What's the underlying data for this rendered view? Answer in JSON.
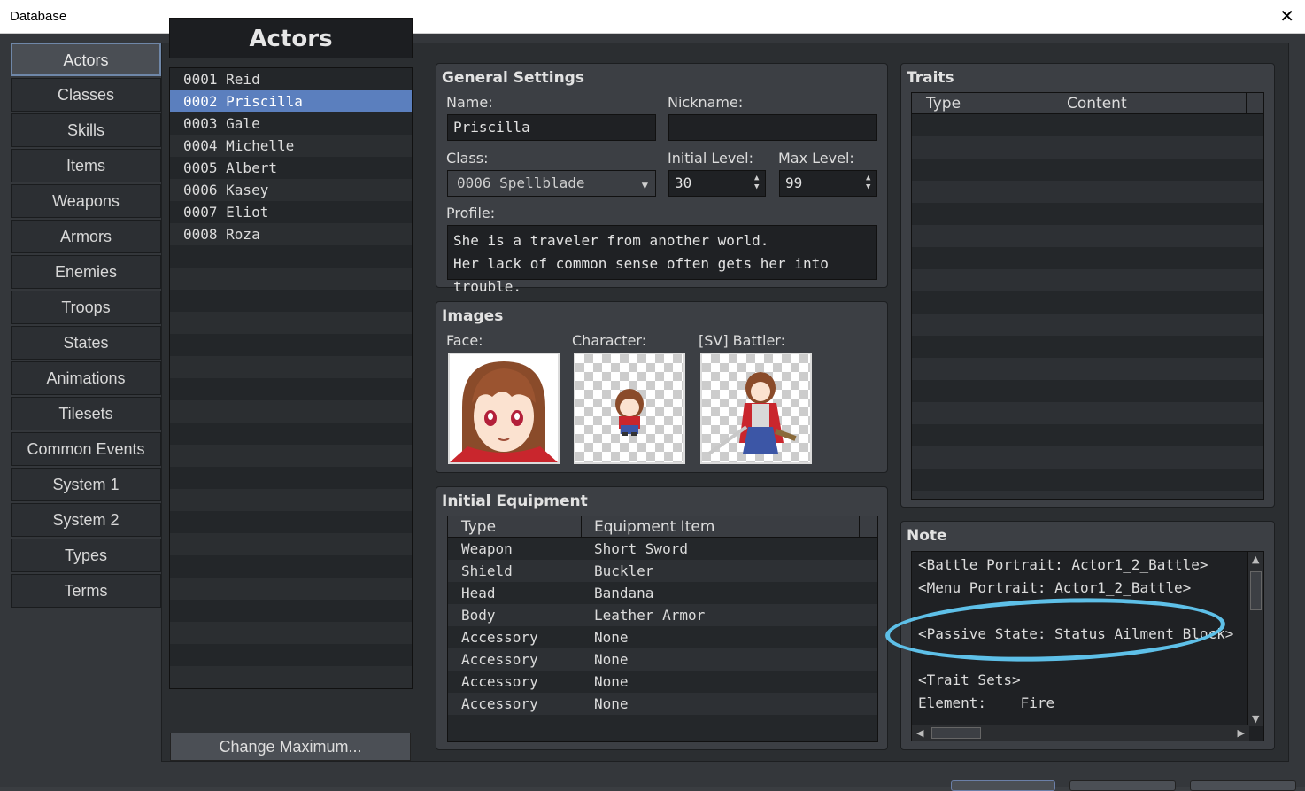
{
  "window": {
    "title": "Database",
    "close_glyph": "✕"
  },
  "categories": [
    {
      "label": "Actors",
      "active": true
    },
    {
      "label": "Classes"
    },
    {
      "label": "Skills"
    },
    {
      "label": "Items"
    },
    {
      "label": "Weapons"
    },
    {
      "label": "Armors"
    },
    {
      "label": "Enemies"
    },
    {
      "label": "Troops"
    },
    {
      "label": "States"
    },
    {
      "label": "Animations"
    },
    {
      "label": "Tilesets"
    },
    {
      "label": "Common Events"
    },
    {
      "label": "System 1"
    },
    {
      "label": "System 2"
    },
    {
      "label": "Types"
    },
    {
      "label": "Terms"
    }
  ],
  "actors": {
    "header": "Actors",
    "items": [
      "0001 Reid",
      "0002 Priscilla",
      "0003 Gale",
      "0004 Michelle",
      "0005 Albert",
      "0006 Kasey",
      "0007 Eliot",
      "0008 Roza"
    ],
    "selected_index": 1,
    "change_max_label": "Change Maximum..."
  },
  "general": {
    "title": "General Settings",
    "name_label": "Name:",
    "name_value": "Priscilla",
    "nickname_label": "Nickname:",
    "nickname_value": "",
    "class_label": "Class:",
    "class_value": "0006 Spellblade",
    "initial_level_label": "Initial Level:",
    "initial_level_value": "30",
    "max_level_label": "Max Level:",
    "max_level_value": "99",
    "profile_label": "Profile:",
    "profile_line1": "She is a traveler from another world.",
    "profile_line2": "Her lack of common sense often gets her into trouble."
  },
  "images": {
    "title": "Images",
    "face_label": "Face:",
    "character_label": "Character:",
    "battler_label": "[SV] Battler:"
  },
  "equipment": {
    "title": "Initial Equipment",
    "col_type": "Type",
    "col_item": "Equipment Item",
    "rows": [
      {
        "type": "Weapon",
        "item": "Short Sword"
      },
      {
        "type": "Shield",
        "item": "Buckler"
      },
      {
        "type": "Head",
        "item": "Bandana"
      },
      {
        "type": "Body",
        "item": "Leather Armor"
      },
      {
        "type": "Accessory",
        "item": "None"
      },
      {
        "type": "Accessory",
        "item": "None"
      },
      {
        "type": "Accessory",
        "item": "None"
      },
      {
        "type": "Accessory",
        "item": "None"
      }
    ]
  },
  "traits": {
    "title": "Traits",
    "col_type": "Type",
    "col_content": "Content"
  },
  "note": {
    "title": "Note",
    "lines": [
      "<Battle Portrait: Actor1_2_Battle>",
      "<Menu Portrait: Actor1_2_Battle>",
      "",
      "<Passive State: Status Ailment Block>",
      "",
      "<Trait Sets>",
      "Element:    Fire"
    ]
  },
  "colors": {
    "highlight": "#5ec0e8",
    "selection": "#5b7fbe"
  }
}
